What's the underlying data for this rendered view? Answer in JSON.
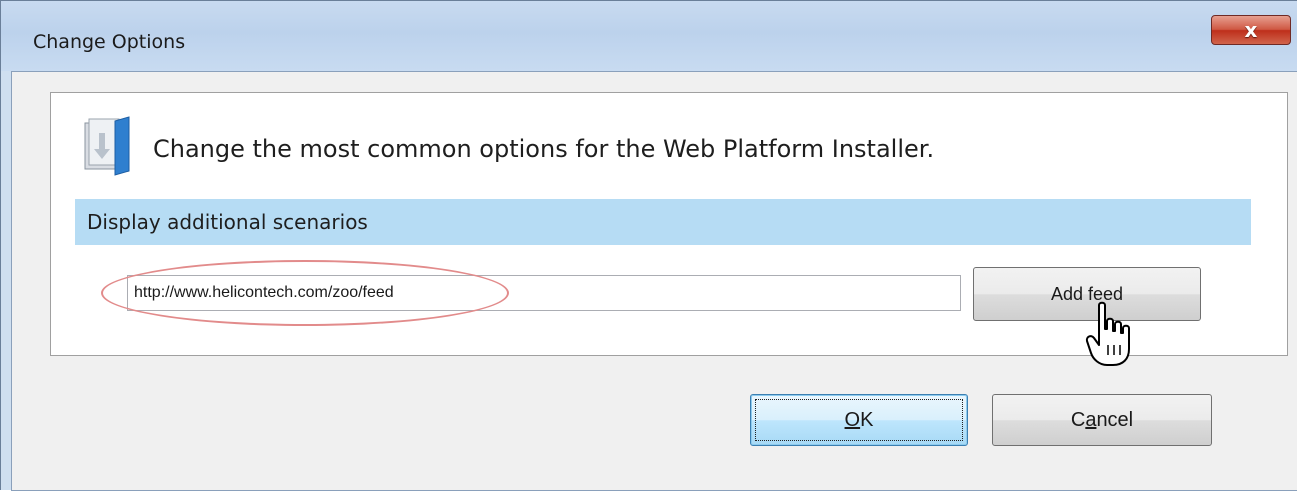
{
  "window": {
    "title": "Change Options",
    "close_label": "x"
  },
  "options": {
    "headline": "Change the most common options for the Web Platform Installer.",
    "section_label": "Display additional scenarios",
    "feed_url_value": "http://www.helicontech.com/zoo/feed",
    "add_feed_label": "Add feed"
  },
  "footer": {
    "ok_label": "OK",
    "ok_mnemonic": "O",
    "ok_rest": "K",
    "cancel_label": "Cancel",
    "cancel_pre": "C",
    "cancel_mnemonic": "a",
    "cancel_rest": "ncel"
  },
  "icons": {
    "installer": "web-platform-installer-icon",
    "cursor": "hand-pointer-icon"
  },
  "colors": {
    "section_band": "#b6dcf4",
    "highlight_oval": "#e28b8b",
    "close_button": "#c9412c",
    "default_button_border": "#3c7fb1"
  }
}
